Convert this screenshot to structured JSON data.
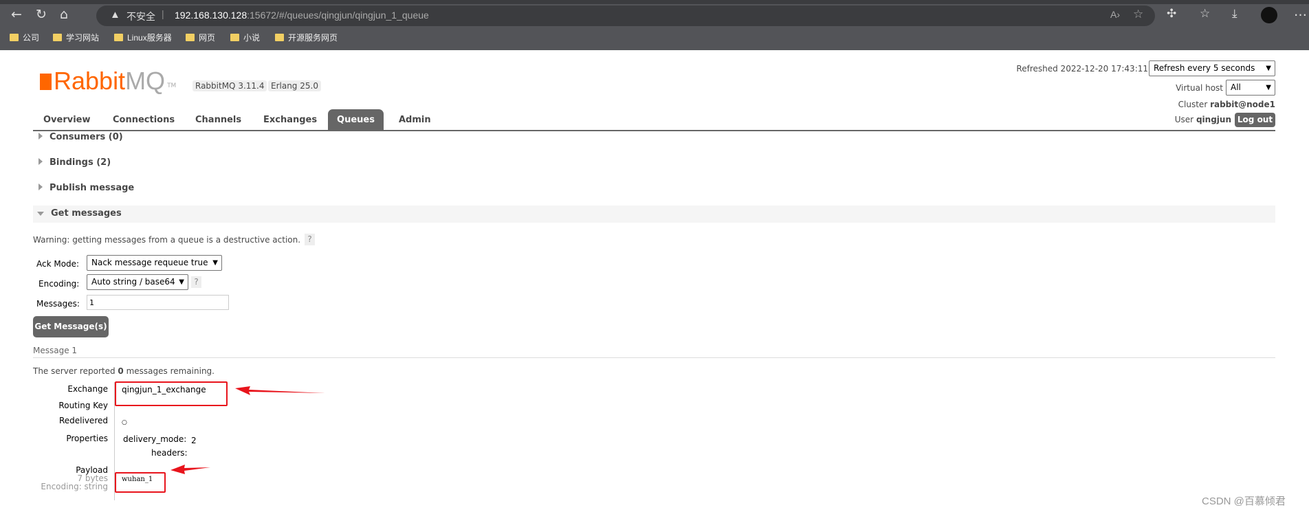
{
  "browser": {
    "security_label": "不安全",
    "url_host": "192.168.130.128",
    "url_rest": ":15672/#/queues/qingjun/qingjun_1_queue",
    "bookmarks": [
      "公司",
      "学习网站",
      "Linux服务器",
      "网页",
      "小说",
      "开源服务网页"
    ]
  },
  "header": {
    "logo_brand": "Rabbit",
    "logo_mq": "MQ",
    "logo_tm": "TM",
    "version_badge": "RabbitMQ 3.11.4",
    "erlang_badge": "Erlang 25.0",
    "refreshed_label": "Refreshed 2022-12-20 17:43:11",
    "refresh_select": "Refresh every 5 seconds",
    "vhost_label": "Virtual host",
    "vhost_select": "All",
    "cluster_label": "Cluster",
    "cluster_value": "rabbit@node1",
    "user_label": "User",
    "user_value": "qingjun",
    "logout_label": "Log out"
  },
  "tabs": [
    {
      "label": "Overview"
    },
    {
      "label": "Connections"
    },
    {
      "label": "Channels"
    },
    {
      "label": "Exchanges"
    },
    {
      "label": "Queues",
      "active": true
    },
    {
      "label": "Admin"
    }
  ],
  "sections": {
    "consumers": "Consumers (0)",
    "bindings": "Bindings (2)",
    "publish": "Publish message",
    "get": "Get messages"
  },
  "get_messages": {
    "warning": "Warning: getting messages from a queue is a destructive action.",
    "help": "?",
    "ack_mode_label": "Ack Mode:",
    "ack_mode_value": "Nack message requeue true",
    "encoding_label": "Encoding:",
    "encoding_value": "Auto string / base64",
    "messages_label": "Messages:",
    "messages_value": "1",
    "button": "Get Message(s)"
  },
  "message": {
    "title": "Message 1",
    "remaining_pre": "The server reported ",
    "remaining_count": "0",
    "remaining_post": " messages remaining.",
    "exchange_label": "Exchange",
    "exchange_value": "qingjun_1_exchange",
    "routing_key_label": "Routing Key",
    "redelivered_label": "Redelivered",
    "redelivered_value": "○",
    "properties_label": "Properties",
    "delivery_mode_label": "delivery_mode:",
    "delivery_mode_value": "2",
    "headers_label": "headers:",
    "payload_label": "Payload",
    "payload_size": "7 bytes",
    "payload_encoding": "Encoding: string",
    "payload_value": "wuhan_1"
  },
  "watermark": "CSDN @百慕倾君",
  "colors": {
    "brand_orange": "#ff6600",
    "annotation_red": "#e8141c",
    "active_tab": "#666666"
  }
}
